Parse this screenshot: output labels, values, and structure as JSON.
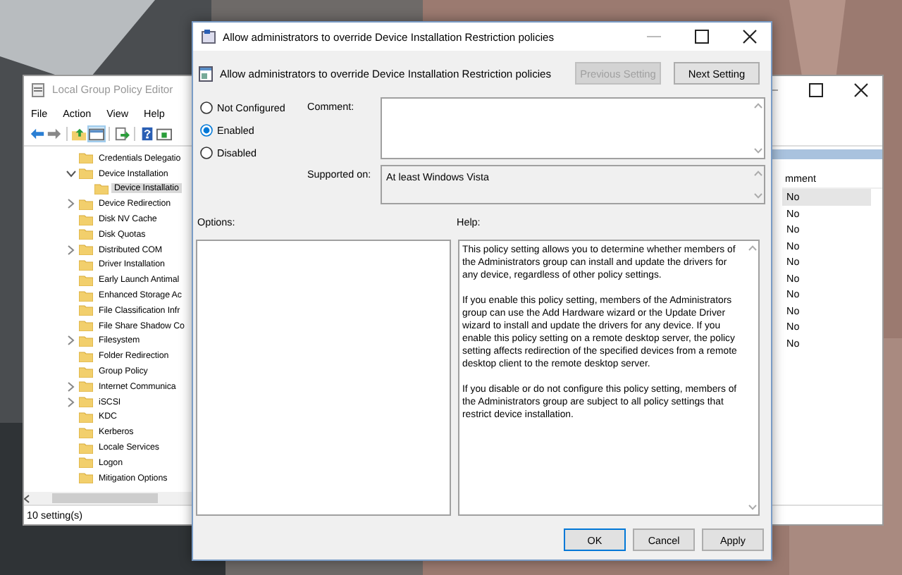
{
  "editor": {
    "title": "Local Group Policy Editor",
    "menu": [
      "File",
      "Action",
      "View",
      "Help"
    ],
    "tree": [
      {
        "label": "Credentials Delegatio",
        "kind": "leaf",
        "selected": false
      },
      {
        "label": "Device Installation",
        "kind": "expanded",
        "selected": false,
        "children": [
          {
            "label": "Device Installatio",
            "selected": true
          }
        ]
      },
      {
        "label": "Device Redirection",
        "kind": "collapsed",
        "selected": false
      },
      {
        "label": "Disk NV Cache",
        "kind": "leaf",
        "selected": false
      },
      {
        "label": "Disk Quotas",
        "kind": "leaf",
        "selected": false
      },
      {
        "label": "Distributed COM",
        "kind": "collapsed",
        "selected": false
      },
      {
        "label": "Driver Installation",
        "kind": "leaf",
        "selected": false
      },
      {
        "label": "Early Launch Antimal",
        "kind": "leaf",
        "selected": false
      },
      {
        "label": "Enhanced Storage Ac",
        "kind": "leaf",
        "selected": false
      },
      {
        "label": "File Classification Infr",
        "kind": "leaf",
        "selected": false
      },
      {
        "label": "File Share Shadow Co",
        "kind": "leaf",
        "selected": false
      },
      {
        "label": "Filesystem",
        "kind": "collapsed",
        "selected": false
      },
      {
        "label": "Folder Redirection",
        "kind": "leaf",
        "selected": false
      },
      {
        "label": "Group Policy",
        "kind": "leaf",
        "selected": false
      },
      {
        "label": "Internet Communica",
        "kind": "collapsed",
        "selected": false
      },
      {
        "label": "iSCSI",
        "kind": "collapsed",
        "selected": false
      },
      {
        "label": "KDC",
        "kind": "leaf",
        "selected": false
      },
      {
        "label": "Kerberos",
        "kind": "leaf",
        "selected": false
      },
      {
        "label": "Locale Services",
        "kind": "leaf",
        "selected": false
      },
      {
        "label": "Logon",
        "kind": "leaf",
        "selected": false
      },
      {
        "label": "Mitigation Options",
        "kind": "leaf",
        "selected": false
      }
    ],
    "column_header": "mment",
    "rows": [
      {
        "comment": "No",
        "selected": true
      },
      {
        "comment": "No",
        "selected": false
      },
      {
        "comment": "No",
        "selected": false
      },
      {
        "comment": "No",
        "selected": false
      },
      {
        "comment": "No",
        "selected": false
      },
      {
        "comment": "No",
        "selected": false
      },
      {
        "comment": "No",
        "selected": false
      },
      {
        "comment": "No",
        "selected": false
      },
      {
        "comment": "No",
        "selected": false
      },
      {
        "comment": "No",
        "selected": false
      }
    ],
    "status_bar": "10 setting(s)"
  },
  "dialog": {
    "title": "Allow administrators to override Device Installation Restriction policies",
    "heading": "Allow administrators to override Device Installation Restriction policies",
    "nav_buttons": [
      {
        "label": "Previous Setting",
        "disabled": true
      },
      {
        "label": "Next Setting",
        "disabled": false
      }
    ],
    "radios": [
      {
        "label": "Not Configured",
        "selected": false
      },
      {
        "label": "Enabled",
        "selected": true
      },
      {
        "label": "Disabled",
        "selected": false
      }
    ],
    "comment_label": "Comment:",
    "supported_label": "Supported on:",
    "supported_value": "At least Windows Vista",
    "options_label": "Options:",
    "help_label": "Help:",
    "help_text": [
      "This policy setting allows you to determine whether members of the Administrators group can install and update the drivers for any device, regardless of other policy settings.",
      "If you enable this policy setting, members of the Administrators group can use the Add Hardware wizard or the Update Driver wizard to install and update the drivers for any device. If you enable this policy setting on a remote desktop server, the policy setting affects redirection of the specified devices from a remote desktop client to the remote desktop server.",
      "If you disable or do not configure this policy setting, members of the Administrators group are subject to all policy settings that restrict device installation."
    ],
    "buttons": [
      {
        "label": "OK",
        "default": true
      },
      {
        "label": "Cancel",
        "default": false
      },
      {
        "label": "Apply",
        "default": false
      }
    ]
  }
}
